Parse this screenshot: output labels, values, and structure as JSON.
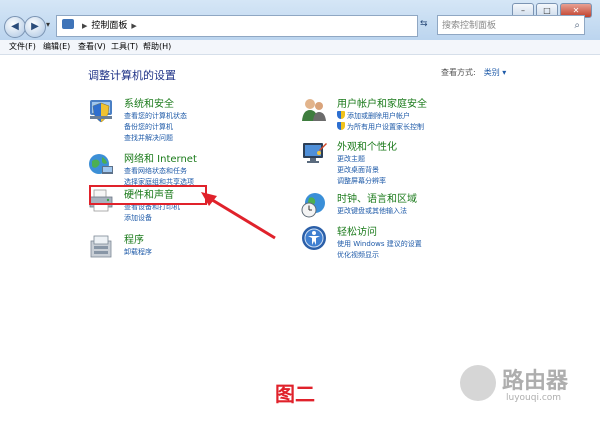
{
  "address": {
    "segment": "控制面板",
    "search_placeholder": "搜索控制面板"
  },
  "menu": [
    "文件(F)",
    "编辑(E)",
    "查看(V)",
    "工具(T)",
    "帮助(H)"
  ],
  "page_title": "调整计算机的设置",
  "view_by": {
    "label": "查看方式:",
    "value": "类别"
  },
  "categories": [
    {
      "title": "系统和安全",
      "icon": "shield-icon",
      "links": [
        "查看您的计算机状态",
        "备份您的计算机",
        "查找并解决问题"
      ]
    },
    {
      "title": "网络和 Internet",
      "icon": "globe-network-icon",
      "links": [
        "查看网络状态和任务",
        "选择家庭组和共享选项"
      ]
    },
    {
      "title": "硬件和声音",
      "icon": "printer-icon",
      "links": [
        "查看设备和打印机",
        "添加设备"
      ]
    },
    {
      "title": "程序",
      "icon": "programs-icon",
      "links": [
        "卸载程序"
      ]
    },
    {
      "title": "用户帐户和家庭安全",
      "icon": "users-icon",
      "links": [
        "添加或删除用户帐户",
        "为所有用户设置家长控制"
      ]
    },
    {
      "title": "外观和个性化",
      "icon": "display-icon",
      "links": [
        "更改主题",
        "更改桌面背景",
        "调整屏幕分辨率"
      ]
    },
    {
      "title": "时钟、语言和区域",
      "icon": "clock-globe-icon",
      "links": [
        "更改键盘或其他输入法"
      ]
    },
    {
      "title": "轻松访问",
      "icon": "accessibility-icon",
      "links": [
        "使用 Windows 建议的设置",
        "优化视频显示"
      ]
    }
  ],
  "figure_label": "图二",
  "watermark": {
    "main": "路由器",
    "sub": "luyouqi.com"
  },
  "colors": {
    "highlight": "#e0222b",
    "link": "#1e5aa8",
    "category": "#1a7a1a"
  }
}
